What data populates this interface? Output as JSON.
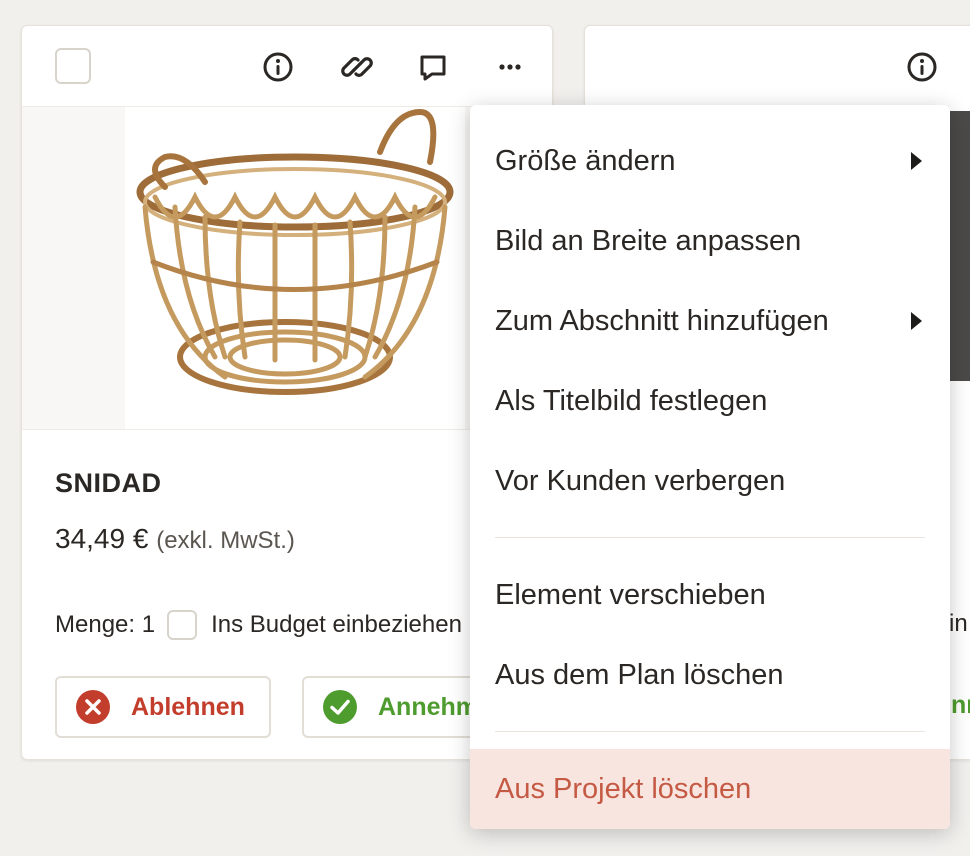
{
  "card": {
    "title": "SNIDAD",
    "price": "34,49 €",
    "price_note": "(exkl. MwSt.)",
    "qty_label": "Menge: 1",
    "budget_label": "Ins Budget einbeziehen",
    "reject_label": "Ablehnen",
    "accept_label": "Annehmen"
  },
  "icons": {
    "info": "info-icon",
    "link": "link-icon",
    "comment": "comment-icon",
    "more": "more-icon"
  },
  "right_card": {
    "partial_text_budget": "in",
    "partial_text_accept": "nn"
  },
  "menu": {
    "items": [
      {
        "label": "Größe ändern",
        "submenu": true
      },
      {
        "label": "Bild an Breite anpassen",
        "submenu": false
      },
      {
        "label": "Zum Abschnitt hinzufügen",
        "submenu": true
      },
      {
        "label": "Als Titelbild festlegen",
        "submenu": false
      },
      {
        "label": "Vor Kunden verbergen",
        "submenu": false
      },
      {
        "label": "Element verschieben",
        "submenu": false
      },
      {
        "label": "Aus dem Plan löschen",
        "submenu": false
      },
      {
        "label": "Aus Projekt löschen",
        "submenu": false,
        "danger": true
      }
    ]
  },
  "colors": {
    "reject": "#c23d2b",
    "accept": "#4e9b2e",
    "danger_bg": "#f8e5e0",
    "danger_text": "#c55a44"
  }
}
